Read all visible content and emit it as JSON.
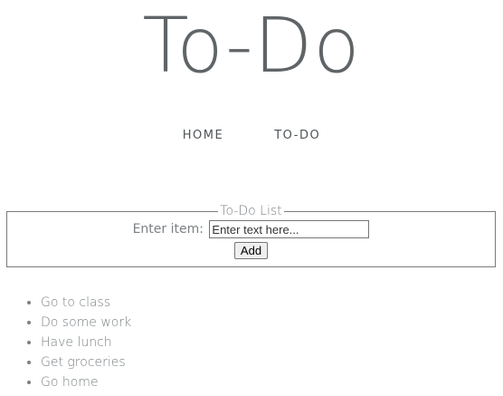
{
  "header": {
    "title": "To-Do"
  },
  "nav": {
    "items": [
      {
        "label": "HOME"
      },
      {
        "label": "TO-DO"
      }
    ]
  },
  "form": {
    "legend": "To-Do List",
    "label": "Enter item:",
    "placeholder": "Enter text here...",
    "value": "",
    "button_label": "Add"
  },
  "list": {
    "items": [
      "Go to class",
      "Do some work",
      "Have lunch",
      "Get groceries",
      "Go home"
    ]
  }
}
